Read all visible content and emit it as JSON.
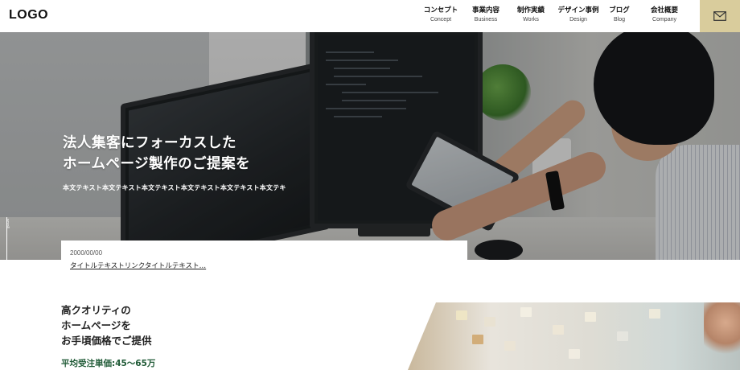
{
  "header": {
    "logo": "LOGO",
    "nav": [
      {
        "jp": "コンセプト",
        "en": "Concept"
      },
      {
        "jp": "事業内容",
        "en": "Business"
      },
      {
        "jp": "制作実績",
        "en": "Works"
      },
      {
        "jp": "デザイン事例",
        "en": "Design"
      },
      {
        "jp": "ブログ",
        "en": "Blog"
      },
      {
        "jp": "会社概要",
        "en": "Company"
      }
    ],
    "contact_icon": "envelope-icon",
    "contact_color": "#d9cc9c"
  },
  "hero": {
    "title_line1": "法人集客にフォーカスした",
    "title_line2": "ホームページ製作のご提案を",
    "subtitle": "本文テキスト本文テキスト本文テキスト本文テキスト本文テキスト本文テキ",
    "scroll_label": "scroll"
  },
  "news": {
    "date": "2000/00/00",
    "title": "タイトルテキストリンクタイトルテキスト…"
  },
  "section": {
    "heading_line1": "高クオリティの",
    "heading_line2": "ホームページを",
    "heading_line3": "お手頃価格でご提供",
    "price": "平均受注単価:45〜65万",
    "price_color": "#1f5a36"
  }
}
